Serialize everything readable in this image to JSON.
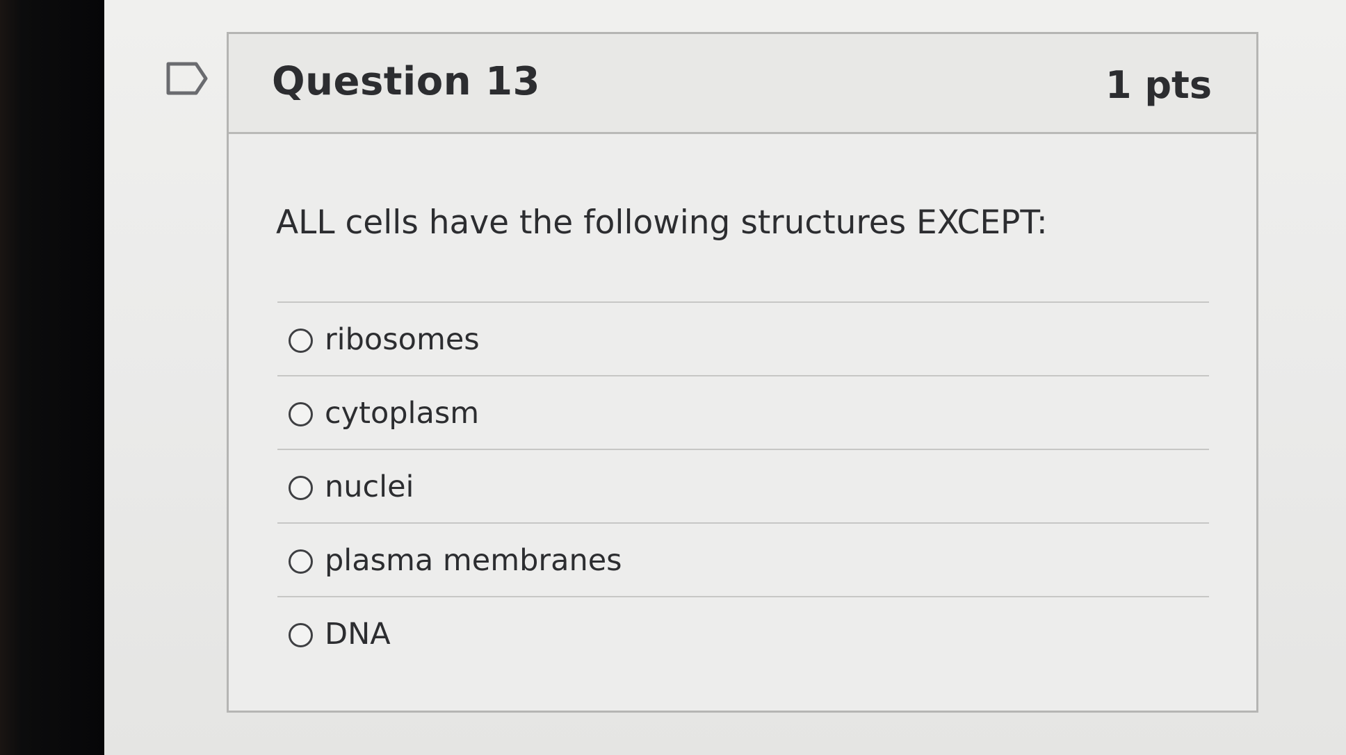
{
  "question": {
    "title": "Question 13",
    "points": "1 pts",
    "prompt": "ALL cells have the following structures EXCEPT:",
    "flag_icon": "flag-outline-icon"
  },
  "answers": [
    {
      "label": "ribosomes",
      "selected": false
    },
    {
      "label": "cytoplasm",
      "selected": false
    },
    {
      "label": "nuclei",
      "selected": false
    },
    {
      "label": "plasma membranes",
      "selected": false
    },
    {
      "label": "DNA",
      "selected": false
    }
  ],
  "colors": {
    "text": "#2c2d30",
    "border": "#b5b5b3",
    "header_bg": "#e8e8e6",
    "page_bg": "#ededec"
  }
}
